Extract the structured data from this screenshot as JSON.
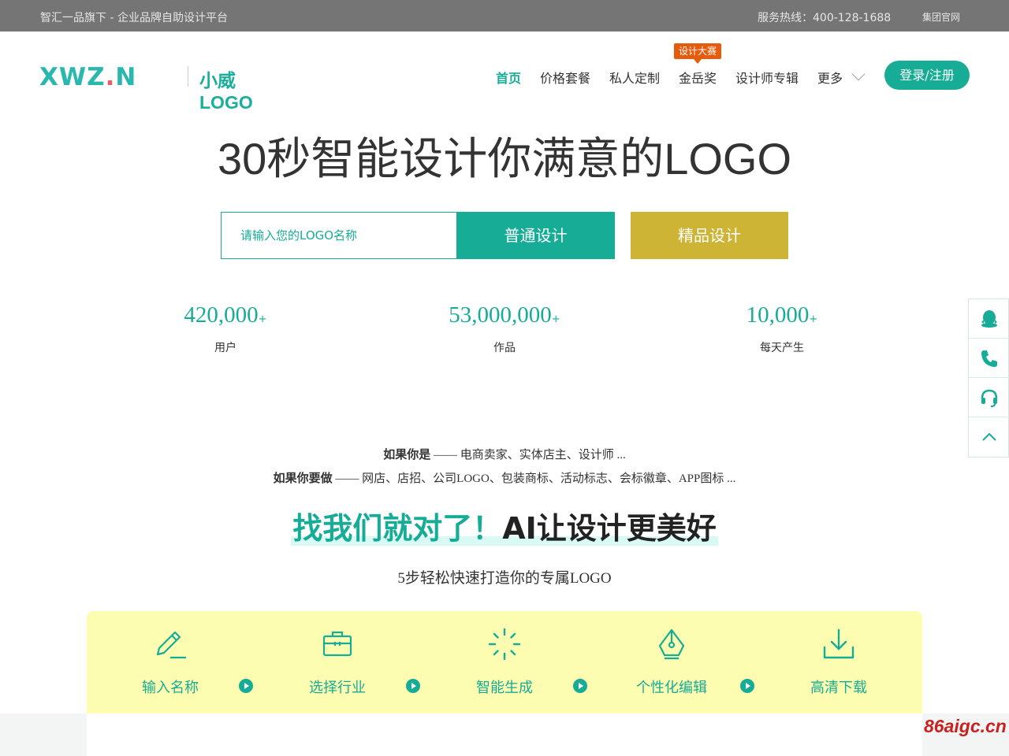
{
  "topbar": {
    "slogan": "智汇一品旗下 - 企业品牌自助设计平台",
    "hotline": "服务热线：400-128-1688",
    "group_site": "集团官网"
  },
  "logo": {
    "mark_left": "XWZ",
    "mark_dot": ".",
    "mark_right": "N",
    "name": "小威LOGO"
  },
  "nav": {
    "items": [
      "首页",
      "价格套餐",
      "私人定制",
      "金岳奖",
      "设计师专辑",
      "更多"
    ],
    "badge": "设计大赛",
    "login": "登录/注册"
  },
  "hero": {
    "title": "30秒智能设计你满意的LOGO",
    "placeholder": "请输入您的LOGO名称",
    "btn_normal": "普通设计",
    "btn_premium": "精品设计"
  },
  "stats": [
    {
      "value": "420,000",
      "suffix": "+",
      "label": "用户"
    },
    {
      "value": "53,000,000",
      "suffix": "+",
      "label": "作品"
    },
    {
      "value": "10,000",
      "suffix": "+",
      "label": "每天产生"
    }
  ],
  "side": [
    "qq-icon",
    "phone-icon",
    "headset-icon",
    "back-to-top-icon"
  ],
  "who": {
    "line1_bold": "如果你是",
    "line1_rest": " —— 电商卖家、实体店主、设计师 ...",
    "line2_bold": "如果你要做",
    "line2_rest": " —— 网店、店招、公司LOGO、包装商标、活动标志、会标徽章、APP图标 ..."
  },
  "cta": {
    "green": "找我们就对了！",
    "dark": "AI让设计更美好"
  },
  "steps_sub": "5步轻松快速打造你的专属LOGO",
  "steps": [
    {
      "label": "输入名称",
      "icon": "pencil-icon"
    },
    {
      "label": "选择行业",
      "icon": "briefcase-icon"
    },
    {
      "label": "智能生成",
      "icon": "loading-icon"
    },
    {
      "label": "个性化编辑",
      "icon": "pen-nib-icon"
    },
    {
      "label": "高清下载",
      "icon": "download-icon"
    }
  ],
  "watermark": "86aigc.cn",
  "colors": {
    "accent": "#16ac96",
    "gold": "#cdb434",
    "badge": "#e65c0c",
    "steps_bg": "#fdfdb2"
  }
}
